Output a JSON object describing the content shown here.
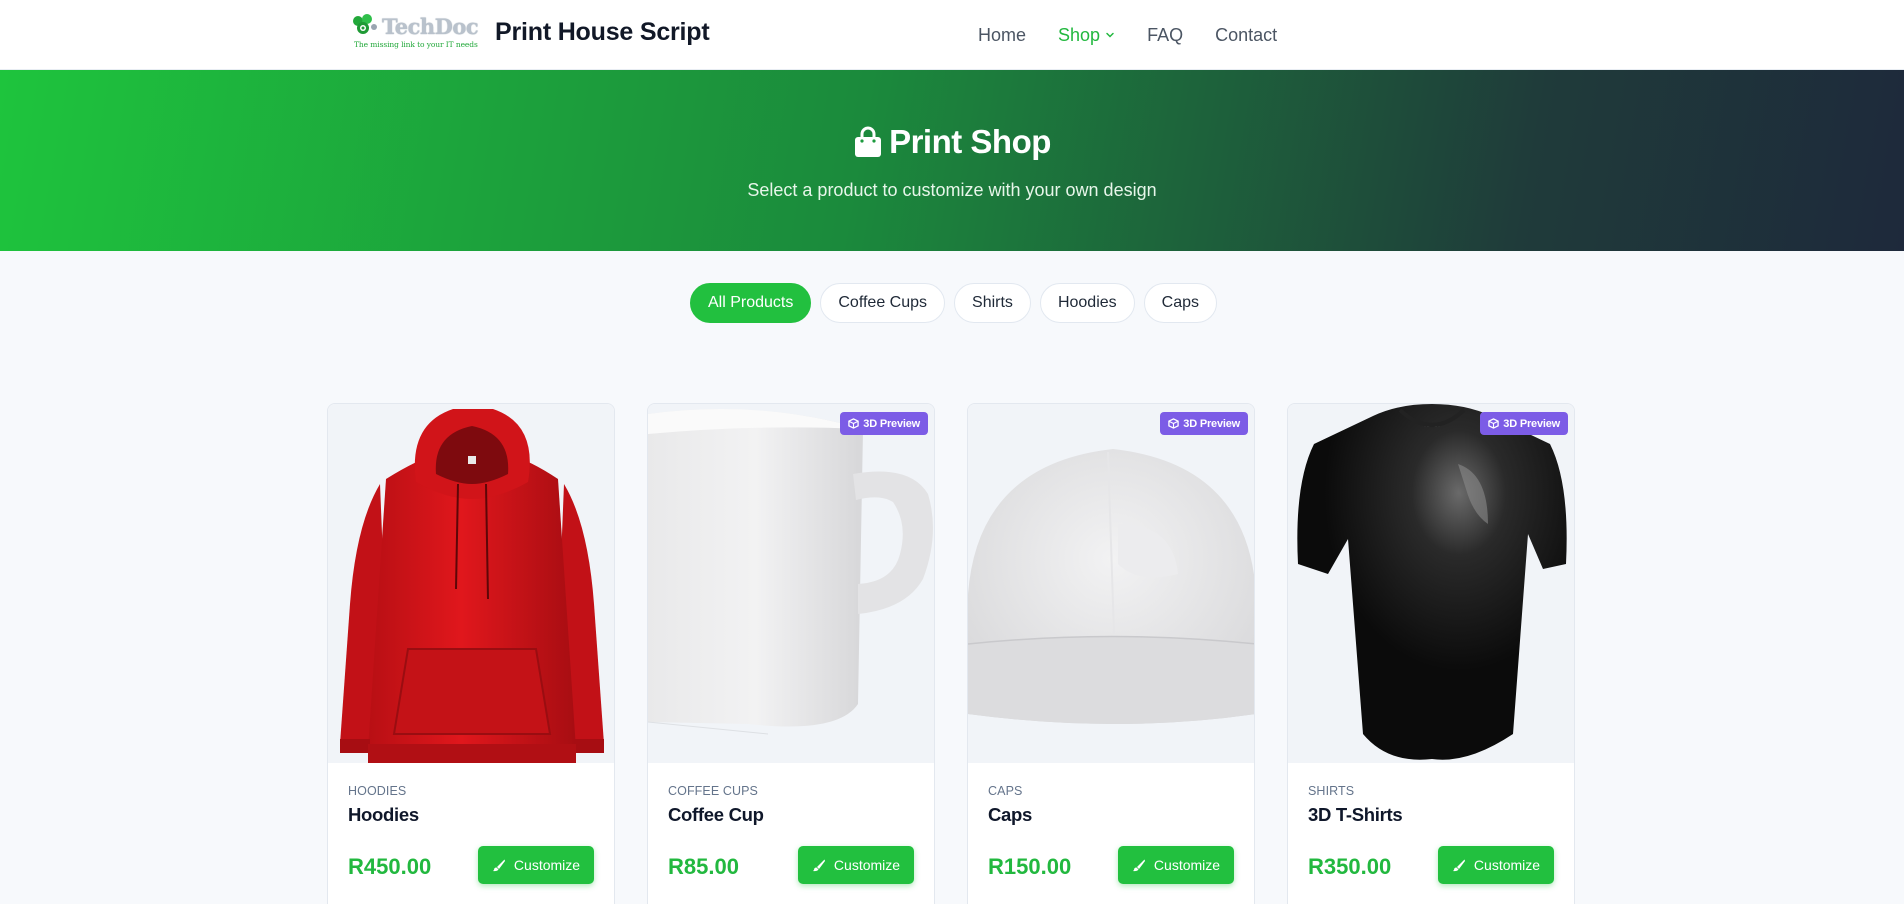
{
  "header": {
    "logo": {
      "word": "TechDoc",
      "tagline": "The missing link to your IT needs"
    },
    "brand_title": "Print House Script",
    "nav": [
      {
        "label": "Home",
        "active": false
      },
      {
        "label": "Shop",
        "active": true,
        "dropdown": true
      },
      {
        "label": "FAQ",
        "active": false
      },
      {
        "label": "Contact",
        "active": false
      }
    ]
  },
  "hero": {
    "icon": "shopping-bag-icon",
    "title": "Print Shop",
    "subtitle": "Select a product to customize with your own design"
  },
  "filters": [
    {
      "label": "All Products",
      "active": true
    },
    {
      "label": "Coffee Cups",
      "active": false
    },
    {
      "label": "Shirts",
      "active": false
    },
    {
      "label": "Hoodies",
      "active": false
    },
    {
      "label": "Caps",
      "active": false
    }
  ],
  "products": [
    {
      "category": "HOODIES",
      "name": "Hoodies",
      "price": "R450.00",
      "button": "Customize",
      "badge": "",
      "image": "red-hoodie"
    },
    {
      "category": "COFFEE CUPS",
      "name": "Coffee Cup",
      "price": "R85.00",
      "button": "Customize",
      "badge": "3D Preview",
      "image": "white-mug"
    },
    {
      "category": "CAPS",
      "name": "Caps",
      "price": "R150.00",
      "button": "Customize",
      "badge": "3D Preview",
      "image": "white-cap"
    },
    {
      "category": "SHIRTS",
      "name": "3D T-Shirts",
      "price": "R350.00",
      "button": "Customize",
      "badge": "3D Preview",
      "image": "black-tshirt"
    }
  ],
  "colors": {
    "accent": "#22c03f",
    "badge": "#7c5ce6",
    "price": "#22b83f"
  }
}
